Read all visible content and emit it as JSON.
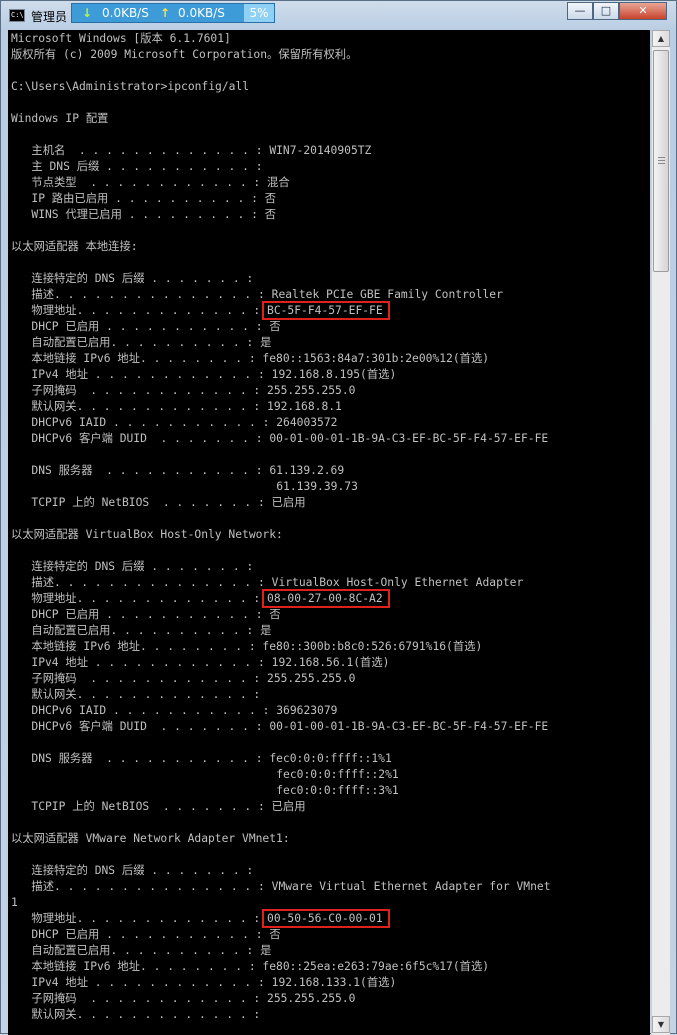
{
  "window": {
    "title": "管理员",
    "download_speed": "0.0KB/S",
    "upload_speed": "0.0KB/S",
    "cpu_percent": "5%",
    "icon_label": "C:\\",
    "minimize_label": "—",
    "maximize_label": "□",
    "close_label": "✕"
  },
  "console": {
    "lines": [
      "Microsoft Windows [版本 6.1.7601]",
      "版权所有 (c) 2009 Microsoft Corporation。保留所有权利。",
      "",
      "C:\\Users\\Administrator>ipconfig/all",
      "",
      "Windows IP 配置",
      "",
      "   主机名  . . . . . . . . . . . . . : WIN7-20140905TZ",
      "   主 DNS 后缀 . . . . . . . . . . . :",
      "   节点类型  . . . . . . . . . . . . : 混合",
      "   IP 路由已启用 . . . . . . . . . . : 否",
      "   WINS 代理已启用 . . . . . . . . . : 否",
      "",
      "以太网适配器 本地连接:",
      "",
      "   连接特定的 DNS 后缀 . . . . . . . :",
      "   描述. . . . . . . . . . . . . . . : Realtek PCIe GBE Family Controller",
      "   物理地址. . . . . . . . . . . . . : BC-5F-F4-57-EF-FE",
      "   DHCP 已启用 . . . . . . . . . . . : 否",
      "   自动配置已启用. . . . . . . . . . : 是",
      "   本地链接 IPv6 地址. . . . . . . . : fe80::1563:84a7:301b:2e00%12(首选)",
      "   IPv4 地址 . . . . . . . . . . . . : 192.168.8.195(首选)",
      "   子网掩码  . . . . . . . . . . . . : 255.255.255.0",
      "   默认网关. . . . . . . . . . . . . : 192.168.8.1",
      "   DHCPv6 IAID . . . . . . . . . . . : 264003572",
      "   DHCPv6 客户端 DUID  . . . . . . . : 00-01-00-01-1B-9A-C3-EF-BC-5F-F4-57-EF-FE",
      "",
      "   DNS 服务器  . . . . . . . . . . . : 61.139.2.69",
      "                                       61.139.39.73",
      "   TCPIP 上的 NetBIOS  . . . . . . . : 已启用",
      "",
      "以太网适配器 VirtualBox Host-Only Network:",
      "",
      "   连接特定的 DNS 后缀 . . . . . . . :",
      "   描述. . . . . . . . . . . . . . . : VirtualBox Host-Only Ethernet Adapter",
      "   物理地址. . . . . . . . . . . . . : 08-00-27-00-8C-A2",
      "   DHCP 已启用 . . . . . . . . . . . : 否",
      "   自动配置已启用. . . . . . . . . . : 是",
      "   本地链接 IPv6 地址. . . . . . . . : fe80::300b:b8c0:526:6791%16(首选)",
      "   IPv4 地址 . . . . . . . . . . . . : 192.168.56.1(首选)",
      "   子网掩码  . . . . . . . . . . . . : 255.255.255.0",
      "   默认网关. . . . . . . . . . . . . :",
      "   DHCPv6 IAID . . . . . . . . . . . : 369623079",
      "   DHCPv6 客户端 DUID  . . . . . . . : 00-01-00-01-1B-9A-C3-EF-BC-5F-F4-57-EF-FE",
      "",
      "   DNS 服务器  . . . . . . . . . . . : fec0:0:0:ffff::1%1",
      "                                       fec0:0:0:ffff::2%1",
      "                                       fec0:0:0:ffff::3%1",
      "   TCPIP 上的 NetBIOS  . . . . . . . : 已启用",
      "",
      "以太网适配器 VMware Network Adapter VMnet1:",
      "",
      "   连接特定的 DNS 后缀 . . . . . . . :",
      "   描述. . . . . . . . . . . . . . . : VMware Virtual Ethernet Adapter for VMnet",
      "1",
      "   物理地址. . . . . . . . . . . . . : 00-50-56-C0-00-01",
      "   DHCP 已启用 . . . . . . . . . . . : 否",
      "   自动配置已启用. . . . . . . . . . : 是",
      "   本地链接 IPv6 地址. . . . . . . . : fe80::25ea:e263:79ae:6f5c%17(首选)",
      "   IPv4 地址 . . . . . . . . . . . . : 192.168.133.1(首选)",
      "   子网掩码  . . . . . . . . . . . . : 255.255.255.0",
      "   默认网关. . . . . . . . . . . . . :"
    ]
  },
  "highlights": [
    "BC-5F-F4-57-EF-FE",
    "08-00-27-00-8C-A2",
    "00-50-56-C0-00-01"
  ],
  "colors": {
    "console_bg": "#000000",
    "console_text": "#c0c0c0",
    "highlight": "#e0211b",
    "netbar": "#3d9bd8"
  },
  "scrollbar": {
    "up_label": "▲",
    "down_label": "▼"
  }
}
